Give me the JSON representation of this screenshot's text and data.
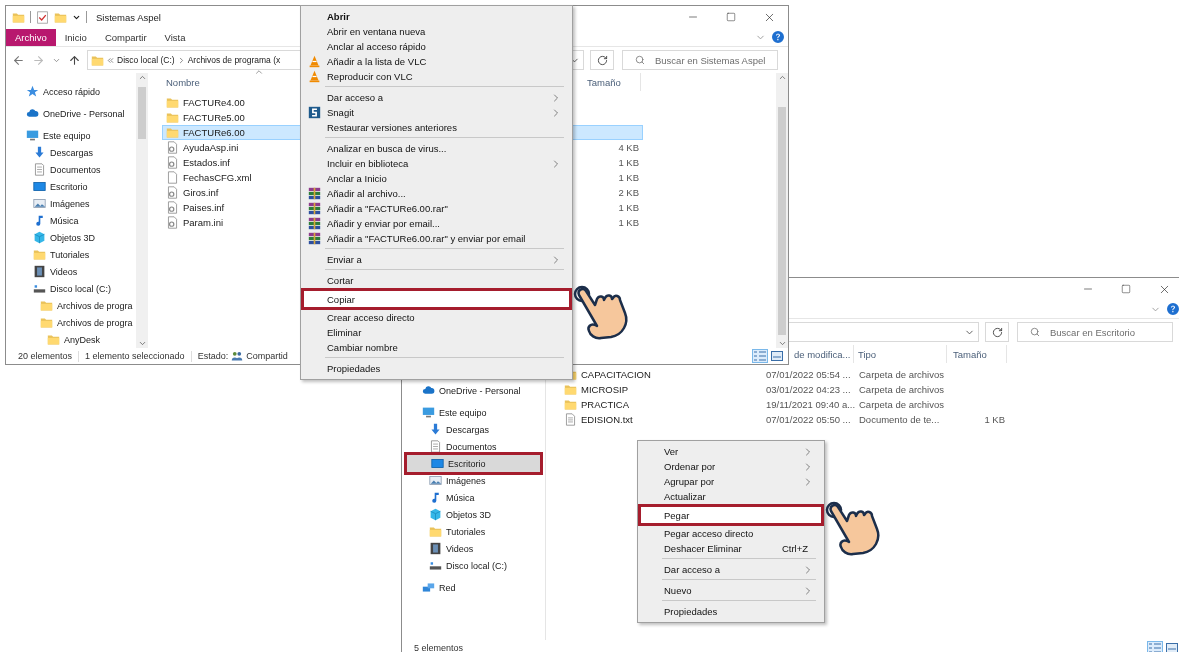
{
  "windows": [
    {
      "title": "Sistemas Aspel",
      "tabs": [
        {
          "label": "Archivo",
          "kind": "file"
        },
        {
          "label": "Inicio",
          "kind": "tab"
        },
        {
          "label": "Compartir",
          "kind": "tab"
        },
        {
          "label": "Vista",
          "kind": "tab"
        }
      ],
      "address": [
        "Disco local (C:)",
        "Archivos de programa (x"
      ],
      "search": {
        "placeholder": "Buscar en Sistemas Aspel"
      },
      "nav": [
        {
          "label": "Acceso rápido",
          "kind": "star",
          "selected": false,
          "highlighted": false
        },
        {
          "label": "OneDrive - Personal",
          "kind": "cloud",
          "selected": false,
          "highlighted": false
        },
        {
          "label": "Este equipo",
          "kind": "monitor",
          "selected": false,
          "highlighted": false,
          "children": [
            {
              "label": "Descargas",
              "kind": "download",
              "selected": false,
              "highlighted": false
            },
            {
              "label": "Documentos",
              "kind": "document",
              "selected": false,
              "highlighted": false
            },
            {
              "label": "Escritorio",
              "kind": "desktop",
              "selected": false,
              "highlighted": false
            },
            {
              "label": "Imágenes",
              "kind": "pictures",
              "selected": false,
              "highlighted": false
            },
            {
              "label": "Música",
              "kind": "music",
              "selected": false,
              "highlighted": false
            },
            {
              "label": "Objetos 3D",
              "kind": "cube",
              "selected": false,
              "highlighted": false
            },
            {
              "label": "Tutoriales",
              "kind": "folder",
              "selected": false,
              "highlighted": false
            },
            {
              "label": "Videos",
              "kind": "video",
              "selected": false,
              "highlighted": false
            },
            {
              "label": "Disco local (C:)",
              "kind": "drive",
              "selected": false,
              "highlighted": false,
              "children": [
                {
                  "label": "Archivos de progra",
                  "kind": "folder",
                  "selected": false,
                  "highlighted": false
                },
                {
                  "label": "Archivos de progra",
                  "kind": "folder",
                  "selected": false,
                  "highlighted": false,
                  "children": [
                    {
                      "label": "AnyDesk",
                      "kind": "folder",
                      "selected": false,
                      "highlighted": false
                    }
                  ]
                }
              ]
            }
          ]
        }
      ],
      "columns": [
        {
          "kind": "name",
          "label": "Nombre",
          "sorted": true
        },
        {
          "kind": "size",
          "label": "Tamaño",
          "sorted": false
        }
      ],
      "rows": [
        {
          "name": "FACTURe4.00",
          "kind": "folder",
          "selected": false
        },
        {
          "name": "FACTURe5.00",
          "kind": "folder",
          "selected": false
        },
        {
          "name": "FACTURe6.00",
          "kind": "folder",
          "selected": true
        },
        {
          "name": "AyudaAsp.ini",
          "kind": "config-file",
          "size": "4 KB",
          "selected": false
        },
        {
          "name": "Estados.inf",
          "kind": "config-file",
          "size": "1 KB",
          "selected": false
        },
        {
          "name": "FechasCFG.xml",
          "kind": "file",
          "size": "1 KB",
          "selected": false
        },
        {
          "name": "Giros.inf",
          "kind": "config-file",
          "size": "2 KB",
          "selected": false
        },
        {
          "name": "Paises.inf",
          "kind": "config-file",
          "size": "1 KB",
          "selected": false
        },
        {
          "name": "Param.ini",
          "kind": "config-file",
          "size": "1 KB",
          "selected": false
        }
      ],
      "status": {
        "items": [
          "20 elementos",
          "1 elemento seleccionado"
        ],
        "state_label": "Estado:",
        "state_value": "Compartid"
      }
    },
    {
      "search": {
        "placeholder": "Buscar en Escritorio"
      },
      "nav": [
        {
          "label": "OneDrive - Personal",
          "kind": "cloud",
          "selected": false,
          "highlighted": false
        },
        {
          "label": "Este equipo",
          "kind": "monitor",
          "selected": false,
          "highlighted": false,
          "children": [
            {
              "label": "Descargas",
              "kind": "download",
              "selected": false,
              "highlighted": false
            },
            {
              "label": "Documentos",
              "kind": "document",
              "selected": false,
              "highlighted": false
            },
            {
              "label": "Escritorio",
              "kind": "desktop",
              "selected": true,
              "highlighted": true
            },
            {
              "label": "Imágenes",
              "kind": "pictures",
              "selected": false,
              "highlighted": false
            },
            {
              "label": "Música",
              "kind": "music",
              "selected": false,
              "highlighted": false
            },
            {
              "label": "Objetos 3D",
              "kind": "cube",
              "selected": false,
              "highlighted": false
            },
            {
              "label": "Tutoriales",
              "kind": "folder",
              "selected": false,
              "highlighted": false
            },
            {
              "label": "Videos",
              "kind": "video",
              "selected": false,
              "highlighted": false
            },
            {
              "label": "Disco local (C:)",
              "kind": "drive",
              "selected": false,
              "highlighted": false
            }
          ]
        },
        {
          "label": "Red",
          "kind": "network",
          "selected": false,
          "highlighted": false
        }
      ],
      "columns": [
        {
          "kind": "date",
          "label": "de modifica...",
          "sorted": false
        },
        {
          "kind": "type",
          "label": "Tipo",
          "sorted": false
        },
        {
          "kind": "size",
          "label": "Tamaño",
          "sorted": false
        }
      ],
      "rows": [
        {
          "name": "CAPACITACION",
          "kind": "folder",
          "date": "07/01/2022 05:54 ...",
          "type": "Carpeta de archivos",
          "selected": false
        },
        {
          "name": "MICROSIP",
          "kind": "folder",
          "date": "03/01/2022 04:23 ...",
          "type": "Carpeta de archivos",
          "selected": false
        },
        {
          "name": "PRACTICA",
          "kind": "folder",
          "date": "19/11/2021 09:40 a...",
          "type": "Carpeta de archivos",
          "selected": false
        },
        {
          "name": "EDISION.txt",
          "kind": "text-file",
          "date": "07/01/2022 05:50 ...",
          "type": "Documento de te...",
          "size": "1 KB",
          "selected": false
        }
      ],
      "status": {
        "items": [
          "5 elementos"
        ]
      }
    }
  ],
  "menus": [
    {
      "items": [
        {
          "kind": "default",
          "label": "Abrir",
          "submenu": false,
          "highlighted": false
        },
        {
          "kind": "item",
          "label": "Abrir en ventana nueva",
          "submenu": false,
          "highlighted": false
        },
        {
          "kind": "item",
          "label": "Anclar al acceso rápido",
          "submenu": false,
          "highlighted": false
        },
        {
          "kind": "cone",
          "label": "Añadir a la lista de VLC",
          "submenu": false,
          "highlighted": false
        },
        {
          "kind": "cone",
          "label": "Reproducir con VLC",
          "submenu": false,
          "highlighted": false
        },
        {
          "kind": "separator"
        },
        {
          "kind": "item",
          "label": "Dar acceso a",
          "submenu": true,
          "highlighted": false
        },
        {
          "kind": "logo",
          "label": "Snagit",
          "submenu": true,
          "highlighted": false
        },
        {
          "kind": "item",
          "label": "Restaurar versiones anteriores",
          "submenu": false,
          "highlighted": false
        },
        {
          "kind": "separator"
        },
        {
          "kind": "item",
          "label": "Analizar en busca de virus...",
          "submenu": false,
          "highlighted": false
        },
        {
          "kind": "item",
          "label": "Incluir en biblioteca",
          "submenu": true,
          "highlighted": false
        },
        {
          "kind": "item",
          "label": "Anclar a Inicio",
          "submenu": false,
          "highlighted": false
        },
        {
          "kind": "archive",
          "label": "Añadir al archivo...",
          "submenu": false,
          "highlighted": false
        },
        {
          "kind": "archive",
          "label": "Añadir a \"FACTURe6.00.rar\"",
          "submenu": false,
          "highlighted": false
        },
        {
          "kind": "archive",
          "label": "Añadir y enviar por email...",
          "submenu": false,
          "highlighted": false
        },
        {
          "kind": "archive",
          "label": "Añadir a \"FACTURe6.00.rar\" y enviar por email",
          "submenu": false,
          "highlighted": false
        },
        {
          "kind": "separator"
        },
        {
          "kind": "item",
          "label": "Enviar a",
          "submenu": true,
          "highlighted": false
        },
        {
          "kind": "separator"
        },
        {
          "kind": "item",
          "label": "Cortar",
          "submenu": false,
          "highlighted": false
        },
        {
          "kind": "item",
          "label": "Copiar",
          "submenu": false,
          "highlighted": true
        },
        {
          "kind": "item",
          "label": "Crear acceso directo",
          "submenu": false,
          "highlighted": false
        },
        {
          "kind": "item",
          "label": "Eliminar",
          "submenu": false,
          "highlighted": false
        },
        {
          "kind": "item",
          "label": "Cambiar nombre",
          "submenu": false,
          "highlighted": false
        },
        {
          "kind": "separator"
        },
        {
          "kind": "item",
          "label": "Propiedades",
          "submenu": false,
          "highlighted": false
        }
      ]
    },
    {
      "items": [
        {
          "kind": "item",
          "label": "Ver",
          "submenu": true,
          "highlighted": false
        },
        {
          "kind": "item",
          "label": "Ordenar por",
          "submenu": true,
          "highlighted": false
        },
        {
          "kind": "item",
          "label": "Agrupar por",
          "submenu": true,
          "highlighted": false
        },
        {
          "kind": "item",
          "label": "Actualizar",
          "submenu": false,
          "highlighted": false
        },
        {
          "kind": "item",
          "label": "Pegar",
          "submenu": false,
          "highlighted": true
        },
        {
          "kind": "item",
          "label": "Pegar acceso directo",
          "submenu": false,
          "highlighted": false
        },
        {
          "kind": "item",
          "label": "Deshacer Eliminar",
          "shortcut": "Ctrl+Z",
          "submenu": false,
          "highlighted": false
        },
        {
          "kind": "separator"
        },
        {
          "kind": "item",
          "label": "Dar acceso a",
          "submenu": true,
          "highlighted": false
        },
        {
          "kind": "separator"
        },
        {
          "kind": "item",
          "label": "Nuevo",
          "submenu": true,
          "highlighted": false
        },
        {
          "kind": "separator"
        },
        {
          "kind": "item",
          "label": "Propiedades",
          "submenu": false,
          "highlighted": false
        }
      ]
    }
  ]
}
